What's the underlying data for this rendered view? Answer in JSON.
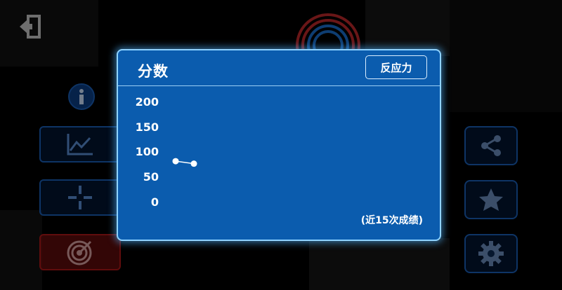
{
  "toolbar": {
    "exit_icon": "exit-icon",
    "info_icon": "info-icon"
  },
  "left_menu": [
    {
      "icon": "chart-line-icon"
    },
    {
      "icon": "crosshair-icon"
    },
    {
      "icon": "target-icon"
    }
  ],
  "right_menu": [
    {
      "icon": "share-icon"
    },
    {
      "icon": "star-icon"
    },
    {
      "icon": "gear-icon"
    }
  ],
  "dialog": {
    "title": "分数",
    "mode_button": "反应力",
    "footnote": "(近15次成绩)"
  },
  "chart_data": {
    "type": "line",
    "title": "",
    "ylim": [
      0,
      200
    ],
    "yticks": [
      "200",
      "150",
      "100",
      "50",
      "0"
    ],
    "series": [
      {
        "values": [
          81,
          76
        ]
      }
    ]
  },
  "colors": {
    "dialog_bg": "#0b5cae",
    "dialog_border": "#8fd3ff",
    "button_border": "#1b5fb8",
    "danger": "#b01818"
  }
}
